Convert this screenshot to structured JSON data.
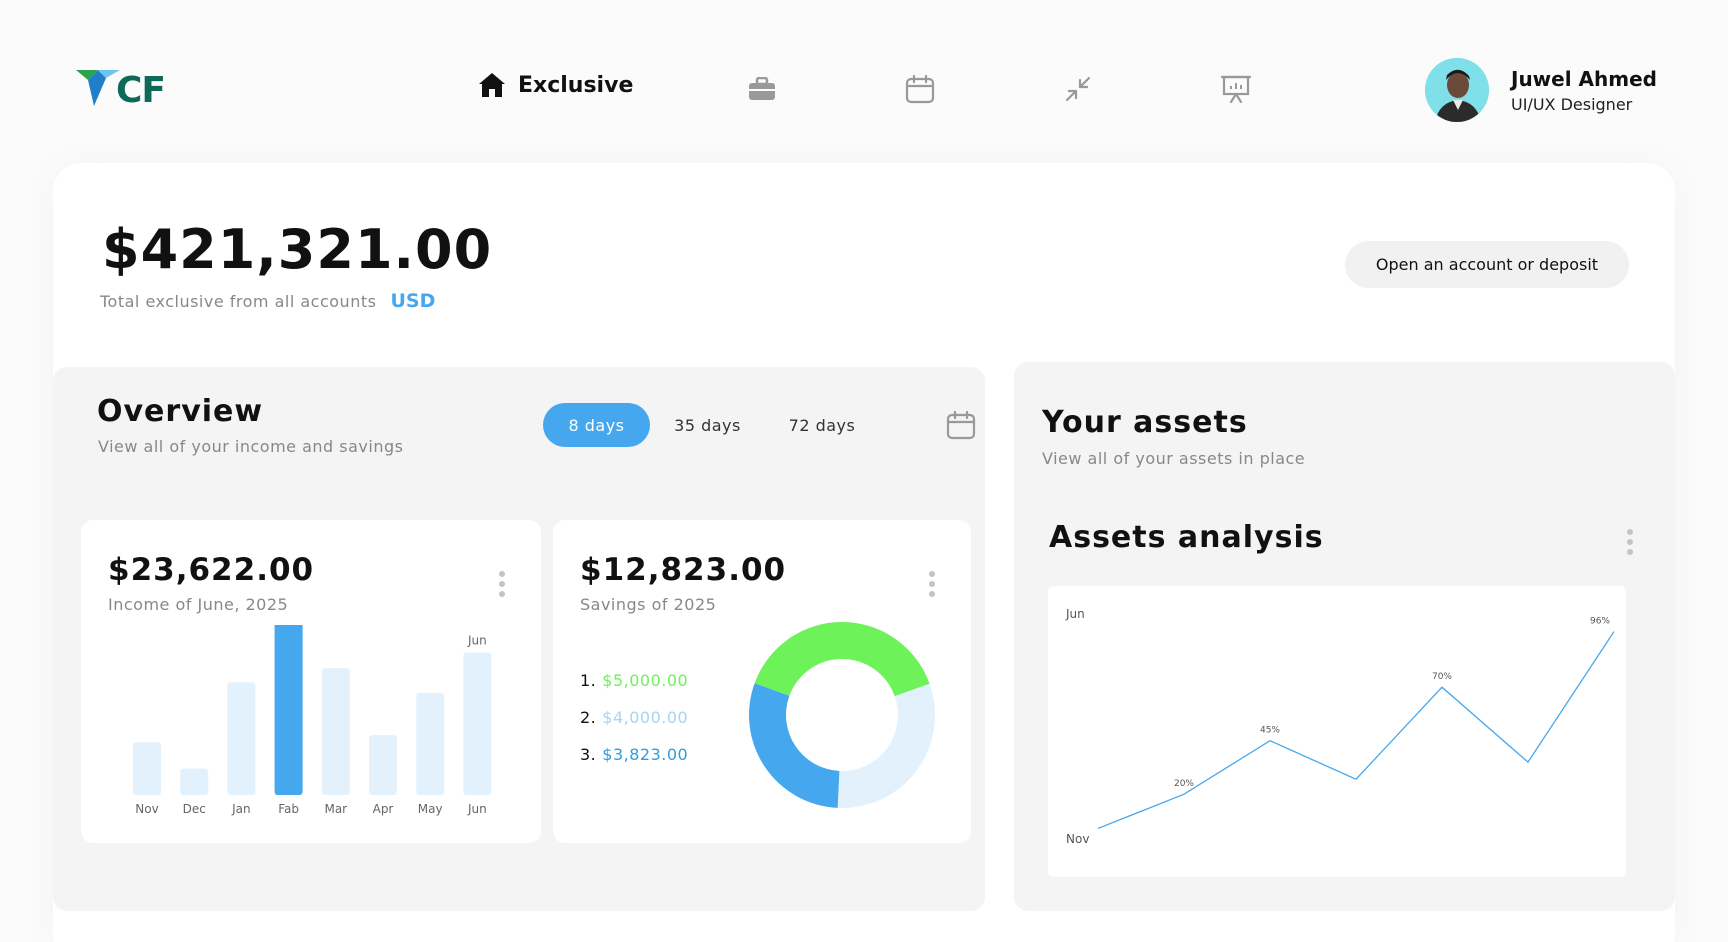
{
  "brand": {
    "logo_text": "CF"
  },
  "nav": {
    "home_label": "Exclusive",
    "icons": [
      "briefcase-icon",
      "calendar-icon",
      "collapse-icon",
      "presentation-icon"
    ]
  },
  "profile": {
    "name": "Juwel Ahmed",
    "role": "UI/UX Designer"
  },
  "balance": {
    "amount": "$421,321.00",
    "caption": "Total exclusive from all accounts",
    "currency": "USD",
    "cta": "Open an account or deposit"
  },
  "overview": {
    "title": "Overview",
    "subtitle": "View all of your income and savings",
    "tabs": [
      {
        "label": "8 days",
        "active": true
      },
      {
        "label": "35 days",
        "active": false
      },
      {
        "label": "72 days",
        "active": false
      }
    ]
  },
  "income": {
    "amount": "$23,622.00",
    "caption": "Income of June, 2025",
    "top_label": "Jun"
  },
  "savings": {
    "amount": "$12,823.00",
    "caption": "Savings of 2025",
    "items": [
      {
        "index": "1.",
        "value": "$5,000.00",
        "color": "#6ef25a"
      },
      {
        "index": "2.",
        "value": "$4,000.00",
        "color": "#a7d4f2"
      },
      {
        "index": "3.",
        "value": "$3,823.00",
        "color": "#2f9fd8"
      }
    ]
  },
  "assets": {
    "title": "Your assets",
    "subtitle": "View all of your assets in place",
    "analysis_title": "Assets analysis"
  },
  "colors": {
    "accent": "#45a8ee",
    "bar_light": "#e3f1fc",
    "green": "#6ef25a",
    "donut_light": "#e3f1fc"
  },
  "chart_data": [
    {
      "type": "bar",
      "categories": [
        "Nov",
        "Dec",
        "Jan",
        "Fab",
        "Mar",
        "Apr",
        "May",
        "Jun"
      ],
      "values": [
        30,
        15,
        64,
        100,
        72,
        34,
        58,
        81
      ],
      "highlight": "Fab",
      "annotations": [
        {
          "category": "Jun",
          "text": "Jun"
        }
      ]
    },
    {
      "type": "pie",
      "donut": true,
      "labels": [
        "$5,000.00",
        "$4,000.00",
        "$3,823.00"
      ],
      "values": [
        5000,
        4000,
        3823
      ],
      "colors": [
        "#6ef25a",
        "#e3f1fc",
        "#45a8ee"
      ]
    },
    {
      "type": "line",
      "y_start_label": "Nov",
      "y_end_label": "Jun",
      "values": [
        4,
        20,
        45,
        27,
        70,
        35,
        96
      ],
      "point_labels": [
        "",
        "20%",
        "45%",
        "",
        "70%",
        "",
        "96%"
      ],
      "ylim": [
        0,
        100
      ]
    }
  ]
}
